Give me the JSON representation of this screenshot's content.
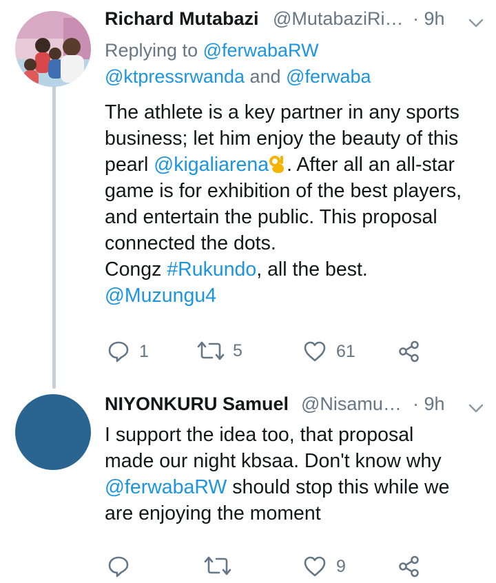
{
  "tweets": [
    {
      "author_name": "Richard Mutabazi",
      "author_handle": "@MutabaziRi…",
      "time": "· 9h",
      "reply_prefix": "Replying to ",
      "reply_to_1": "@ferwabaRW",
      "reply_to_2": "@ktpressrwanda",
      "reply_and": " and ",
      "reply_to_3": "@ferwaba",
      "line1": "The athlete is a key partner in any sports",
      "line2": "business; let him enjoy the beauty of this",
      "line3_pre": "pearl ",
      "line3_mention": "@kigaliarena",
      "line3_post": ". After all an all-star",
      "line4": "game is for exhibition of the best players,",
      "line5": "and entertain the public. This proposal",
      "line6": "connected the dots.",
      "line7_pre": "Congz ",
      "line7_hashtag": "#Rukundo",
      "line7_post": ", all the best.",
      "line8_mention": "@Muzungu4",
      "reply_count": "1",
      "retweet_count": "5",
      "like_count": "61"
    },
    {
      "author_name": "NIYONKURU Samuel",
      "author_handle": "@Nisamu…",
      "time": "· 9h",
      "line1": "I support the idea too,  that proposal",
      "line2": "made our night kbsaa. Don't know why",
      "line3_mention": "@ferwabaRW",
      "line3_post": " should stop this while we",
      "line4": "are enjoying the moment",
      "reply_count": "",
      "retweet_count": "",
      "like_count": "9"
    }
  ],
  "colors": {
    "text": "#14171a",
    "muted": "#657786",
    "link": "#1b95e0",
    "thread_line": "#c4cfd6",
    "avatar2": "#2a6592"
  }
}
